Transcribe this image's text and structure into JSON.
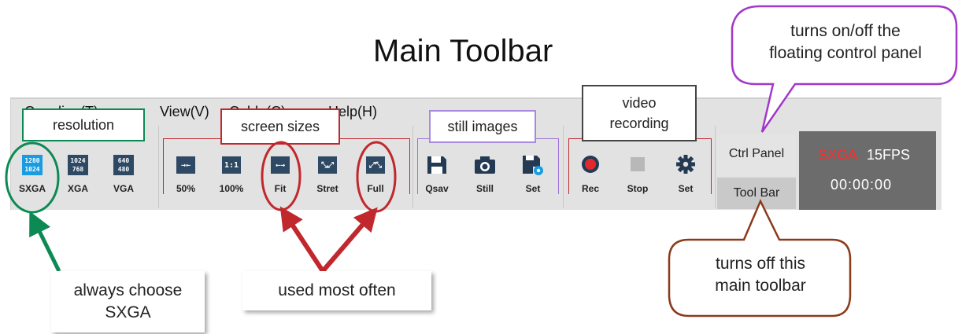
{
  "title": "Main Toolbar",
  "menu": {
    "items": [
      "Coupling(T)",
      "View(V)",
      "Cable(C)",
      "Help(H)"
    ]
  },
  "resolution_group": {
    "callout": "resolution",
    "buttons": [
      {
        "label": "SXGA",
        "icon_text": [
          "1280",
          "1024"
        ],
        "selected": true
      },
      {
        "label": "XGA",
        "icon_text": [
          "1024",
          "768"
        ],
        "selected": false
      },
      {
        "label": "VGA",
        "icon_text": [
          "640",
          "480"
        ],
        "selected": false
      }
    ]
  },
  "screen_sizes_group": {
    "callout": "screen sizes",
    "buttons": [
      {
        "label": "50%",
        "icon_text": "→←",
        "icon": "shrink-icon"
      },
      {
        "label": "100%",
        "icon_text": "1:1",
        "icon": "actual-size-icon"
      },
      {
        "label": "Fit",
        "icon_text": "←→",
        "icon": "fit-icon"
      },
      {
        "label": "Stret",
        "icon_text": "⤡⤢",
        "icon": "stretch-icon"
      },
      {
        "label": "Full",
        "icon_text": "⤢⤡",
        "icon": "fullscreen-icon"
      }
    ]
  },
  "still_images_group": {
    "callout": "still images",
    "buttons": [
      {
        "label": "Qsav",
        "icon": "save-icon"
      },
      {
        "label": "Still",
        "icon": "camera-icon"
      },
      {
        "label": "Set",
        "icon": "save-settings-icon"
      }
    ]
  },
  "video_group": {
    "callout": "video recording",
    "callout_lines": [
      "video",
      "recording"
    ],
    "buttons": [
      {
        "label": "Rec",
        "icon": "record-icon"
      },
      {
        "label": "Stop",
        "icon": "stop-icon"
      },
      {
        "label": "Set",
        "icon": "gear-icon"
      }
    ]
  },
  "side_panel": {
    "ctrl_panel_label": "Ctrl Panel",
    "tool_bar_label": "Tool Bar"
  },
  "status": {
    "resolution": "SXGA",
    "fps": "15FPS",
    "time": "00:00:00"
  },
  "annotations": {
    "always_choose": [
      "always choose",
      "SXGA"
    ],
    "used_most_often": "used most often",
    "ctrl_panel_bubble": [
      "turns on/off the",
      "floating control panel"
    ],
    "tool_bar_bubble": [
      "turns off this",
      "main toolbar"
    ]
  },
  "colors": {
    "red": "#c0282d",
    "green": "#0c8a54",
    "purple": "#a78ae0",
    "brown": "#8b3a1a",
    "toolbar_bg": "#e2e2e2",
    "accent_selected": "#1a9ce0"
  }
}
